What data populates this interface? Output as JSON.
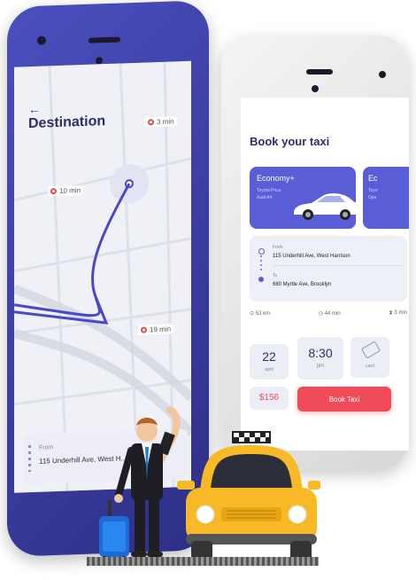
{
  "destination_screen": {
    "back_label": "←",
    "title": "Destination",
    "eta_labels": [
      "3 min",
      "10 min",
      "19 min"
    ],
    "from_label": "From",
    "from_address": "115 Underhill Ave, West H..."
  },
  "booking_screen": {
    "title": "Book your taxi",
    "cars": [
      {
        "name": "Economy+",
        "subtitle_1": "Toyota Prius",
        "subtitle_2": "Audi A4"
      },
      {
        "name": "Ec",
        "subtitle_1": "Toyo",
        "subtitle_2": "Ope"
      }
    ],
    "from_label": "From",
    "from_address": "115 Underhill Ave, West Harrison",
    "to_label": "To",
    "to_address": "680 Myrtle Ave, Brooklyn",
    "stats": {
      "distance": "53 km",
      "duration": "44 min",
      "wait": "3 min"
    },
    "date_day": "22",
    "date_month": "april",
    "time_value": "8:30",
    "time_period": "pm",
    "card_label": "card",
    "price": "$156",
    "book_button": "Book Taxi"
  },
  "colors": {
    "accent_blue": "#5a5ed6",
    "accent_red": "#f04b58",
    "route_line": "#4a48c8",
    "taxi_yellow": "#f8b926"
  },
  "icons": {
    "map_marker": "location-icon",
    "clock": "clock-icon",
    "hourglass": "hourglass-icon",
    "card": "card-icon"
  }
}
